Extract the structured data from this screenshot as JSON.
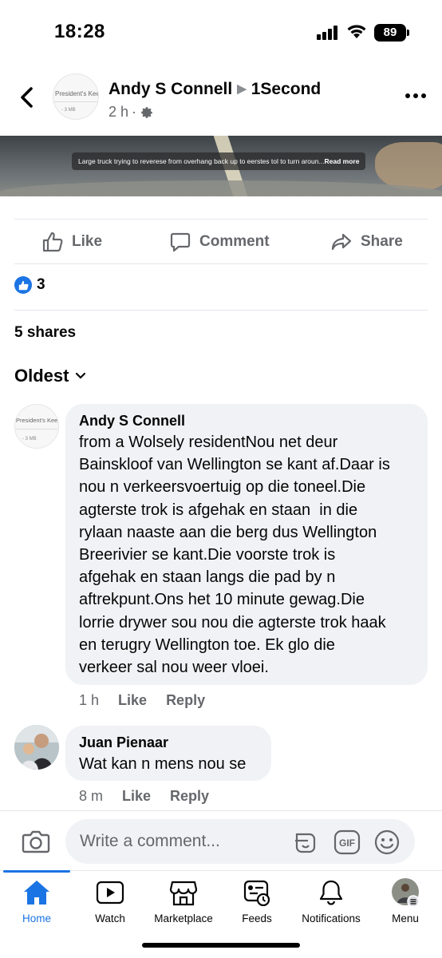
{
  "status_bar": {
    "time": "18:28",
    "battery": "89"
  },
  "post": {
    "author": "Andy S Connell",
    "group": "1Second",
    "time": "2 h",
    "meta_separator": "·",
    "page_avatar_text": "President's Keep",
    "page_avatar_sub": "- 3 MB",
    "video_caption": "Large truck trying to reverese from overhang back up to eerstes tol to turn aroun...",
    "video_caption_more": "Read more"
  },
  "actions": {
    "like": "Like",
    "comment": "Comment",
    "share": "Share"
  },
  "reactions": {
    "count": "3"
  },
  "shares": "5 shares",
  "sort": {
    "label": "Oldest"
  },
  "comments": [
    {
      "name": "Andy S Connell",
      "lines": [
        "from a Wolsely residentNou net deur",
        "Bainskloof van Wellington se kant af.Daar is",
        "nou n verkeersvoertuig op die toneel.Die",
        "agterste trok is afgehak en staan  in die",
        "rylaan naaste aan die berg dus Wellington",
        "Breerivier se kant.Die voorste trok is",
        "afgehak en staan langs die pad by n",
        "aftrekpunt.Ons het 10 minute gewag.Die",
        "lorrie drywer sou nou die agterste trok haak",
        "en terugry Wellington toe. Ek glo die",
        "verkeer sal nou weer vloei."
      ],
      "time": "1 h",
      "like": "Like",
      "reply": "Reply",
      "avatar_text": "President's Keep",
      "avatar_sub": "- 3 MB"
    },
    {
      "name": "Juan Pienaar",
      "lines": [
        "Wat kan n mens nou se"
      ],
      "time": "8 m",
      "like": "Like",
      "reply": "Reply"
    }
  ],
  "composer": {
    "placeholder": "Write a comment..."
  },
  "tabs": [
    {
      "label": "Home",
      "icon": "home-icon"
    },
    {
      "label": "Watch",
      "icon": "watch-icon"
    },
    {
      "label": "Marketplace",
      "icon": "marketplace-icon"
    },
    {
      "label": "Feeds",
      "icon": "feeds-icon"
    },
    {
      "label": "Notifications",
      "icon": "bell-icon"
    },
    {
      "label": "Menu",
      "icon": "menu-avatar-icon"
    }
  ],
  "colors": {
    "accent": "#1b74e4",
    "secondary_text": "#65676b",
    "bubble": "#f0f2f5"
  }
}
